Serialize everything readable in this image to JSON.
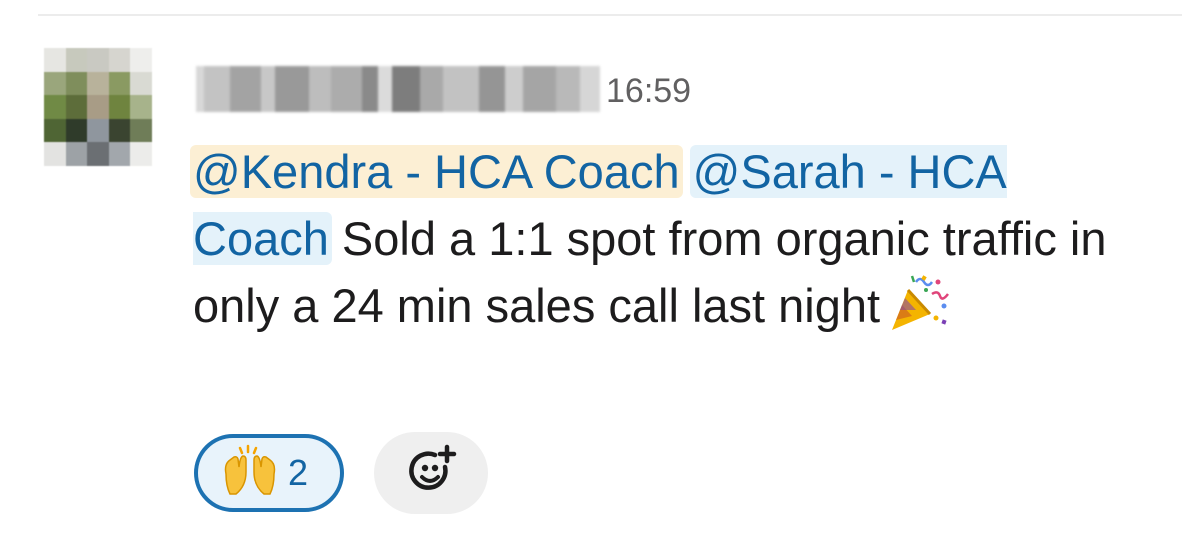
{
  "message": {
    "sender_name": "",
    "timestamp": "16:59",
    "mention_1": "@Kendra - HCA Coach",
    "mention_2": "@Sarah - HCA Coach",
    "text_1": "Sold a 1:1 spot from organic traffic in only a 24 min sales call last night",
    "emoji_icon": "party-popper-icon"
  },
  "reactions": [
    {
      "emoji_icon": "raising-hands-icon",
      "count": "2",
      "selected": true
    }
  ],
  "add_reaction_icon": "add-reaction-icon",
  "colors": {
    "mention_text": "#1264a3",
    "mention_self_bg": "#fcefd4",
    "mention_other_bg": "#e4f2fa",
    "reaction_border": "#1d72b2",
    "reaction_bg": "#e8f3fb",
    "timestamp": "#616061"
  }
}
